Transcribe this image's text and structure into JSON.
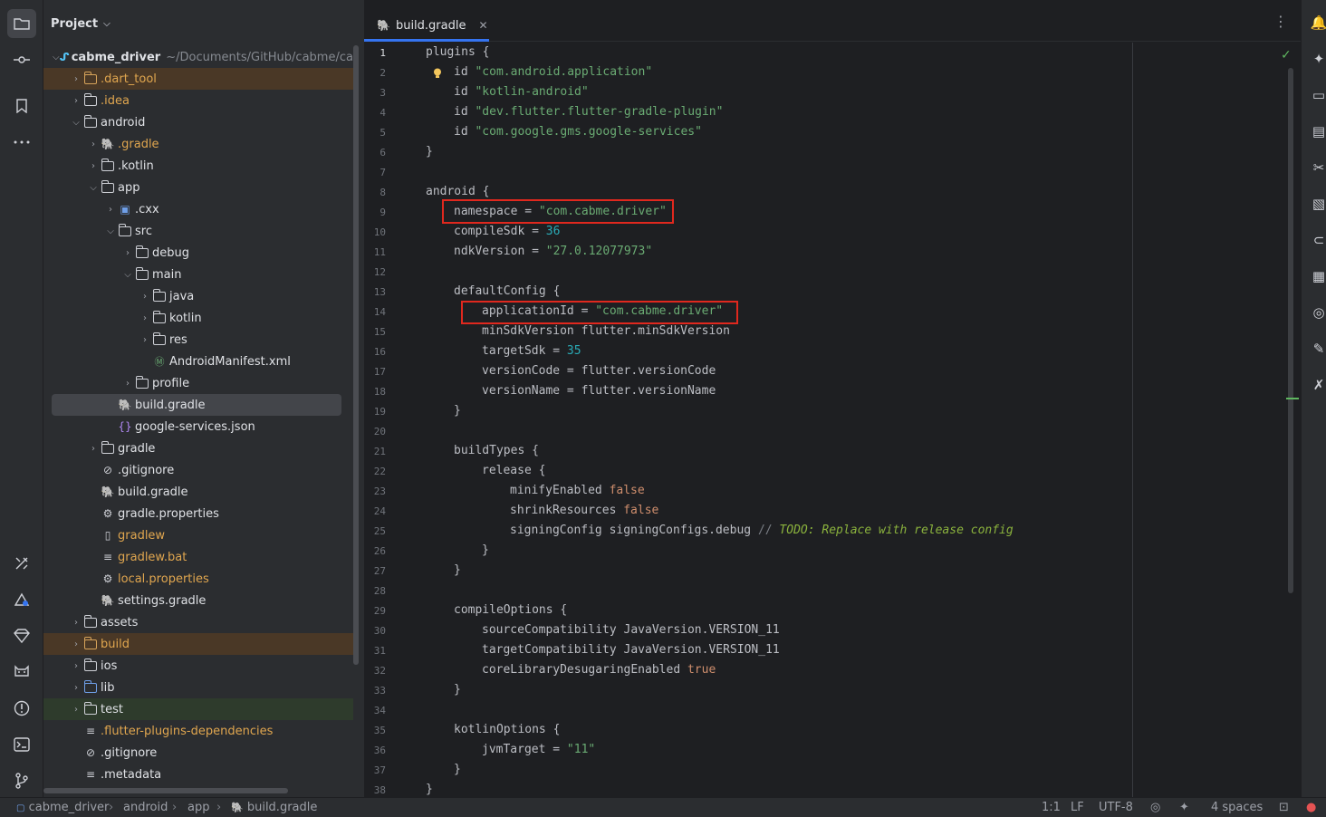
{
  "project_panel": {
    "title": "Project",
    "root": {
      "name": "cabme_driver",
      "path": "~/Documents/GitHub/cabme/cal"
    },
    "items": [
      {
        "label": ".dart_tool"
      },
      {
        "label": ".idea"
      },
      {
        "label": "android"
      },
      {
        "label": ".gradle"
      },
      {
        "label": ".kotlin"
      },
      {
        "label": "app"
      },
      {
        "label": ".cxx"
      },
      {
        "label": "src"
      },
      {
        "label": "debug"
      },
      {
        "label": "main"
      },
      {
        "label": "java"
      },
      {
        "label": "kotlin"
      },
      {
        "label": "res"
      },
      {
        "label": "AndroidManifest.xml"
      },
      {
        "label": "profile"
      },
      {
        "label": "build.gradle"
      },
      {
        "label": "google-services.json"
      },
      {
        "label": "gradle"
      },
      {
        "label": ".gitignore"
      },
      {
        "label": "build.gradle"
      },
      {
        "label": "gradle.properties"
      },
      {
        "label": "gradlew"
      },
      {
        "label": "gradlew.bat"
      },
      {
        "label": "local.properties"
      },
      {
        "label": "settings.gradle"
      },
      {
        "label": "assets"
      },
      {
        "label": "build"
      },
      {
        "label": "ios"
      },
      {
        "label": "lib"
      },
      {
        "label": "test"
      },
      {
        "label": ".flutter-plugins-dependencies"
      },
      {
        "label": ".gitignore"
      },
      {
        "label": ".metadata"
      }
    ]
  },
  "editor": {
    "tab_label": "build.gradle",
    "line_numbers": [
      "1",
      "2",
      "3",
      "4",
      "5",
      "6",
      "7",
      "8",
      "9",
      "10",
      "11",
      "12",
      "13",
      "14",
      "15",
      "16",
      "17",
      "18",
      "19",
      "20",
      "21",
      "22",
      "23",
      "24",
      "25",
      "26",
      "27",
      "28",
      "29",
      "30",
      "31",
      "32",
      "33",
      "34",
      "35",
      "36",
      "37",
      "38"
    ],
    "code": {
      "l1": "plugins {",
      "l2_id": "id ",
      "l2_str": "\"com.android.application\"",
      "l3_id": "id ",
      "l3_str": "\"kotlin-android\"",
      "l4_id": "id ",
      "l4_str": "\"dev.flutter.flutter-gradle-plugin\"",
      "l5_id": "id ",
      "l5_str": "\"com.google.gms.google-services\"",
      "l6": "}",
      "l8": "android {",
      "l9_key": "namespace = ",
      "l9_str": "\"com.cabme.driver\"",
      "l10_key": "compileSdk = ",
      "l10_num": "36",
      "l11_key": "ndkVersion = ",
      "l11_str": "\"27.0.12077973\"",
      "l13": "defaultConfig {",
      "l14_key": "applicationId = ",
      "l14_str": "\"com.cabme.driver\"",
      "l15": "minSdkVersion flutter.minSdkVersion",
      "l16_key": "targetSdk = ",
      "l16_num": "35",
      "l17": "versionCode = flutter.versionCode",
      "l18": "versionName = flutter.versionName",
      "l19": "}",
      "l21": "buildTypes {",
      "l22": "release {",
      "l23_key": "minifyEnabled ",
      "l23_kw": "false",
      "l24_key": "shrinkResources ",
      "l24_kw": "false",
      "l25_key": "signingConfig signingConfigs.debug ",
      "l25_cmt": "// ",
      "l25_todo": "TODO: Replace with release config",
      "l26": "}",
      "l27": "}",
      "l29": "compileOptions {",
      "l30": "sourceCompatibility JavaVersion.VERSION_11",
      "l31": "targetCompatibility JavaVersion.VERSION_11",
      "l32_key": "coreLibraryDesugaringEnabled ",
      "l32_kw": "true",
      "l33": "}",
      "l35": "kotlinOptions {",
      "l36_key": "jvmTarget = ",
      "l36_str": "\"11\"",
      "l37": "}",
      "l38": "}"
    }
  },
  "status_bar": {
    "breadcrumbs": [
      "cabme_driver",
      "android",
      "app",
      "build.gradle"
    ],
    "position": "1:1",
    "line_separator": "LF",
    "encoding": "UTF-8",
    "indent": "4 spaces"
  },
  "colors": {
    "accent": "#3574f0",
    "highlight_box": "#e0281e",
    "string": "#6aab73",
    "keyword": "#cf8e6d",
    "number": "#2aacb8"
  }
}
